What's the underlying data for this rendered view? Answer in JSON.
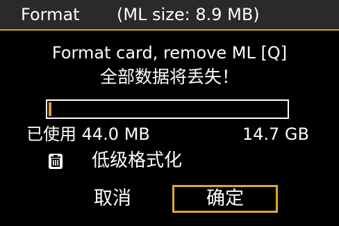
{
  "header": {
    "title": "Format",
    "ml_size": "(ML size: 8.9 MB)"
  },
  "dialog": {
    "message_line1": "Format card, remove ML [Q]",
    "message_line2": "全部数据将丢失！"
  },
  "usage": {
    "used_label": "已使用 44.0 MB",
    "total_label": "14.7 GB",
    "used_fraction": 0.003
  },
  "low_level": {
    "icon": "trash-icon",
    "label": "低级格式化"
  },
  "buttons": {
    "cancel_label": "取消",
    "ok_label": "确定"
  },
  "colors": {
    "accent": "#d9a232",
    "header_bg": "#2a2a2a",
    "background": "#000000",
    "text": "#ffffff"
  }
}
